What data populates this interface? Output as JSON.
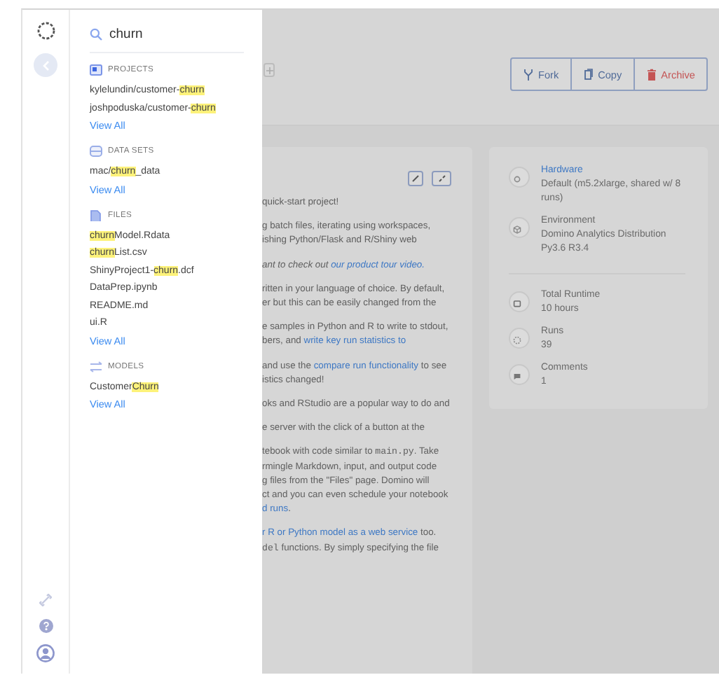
{
  "search": {
    "value": "churn"
  },
  "results": [
    {
      "kind": "projects",
      "heading": "PROJECTS",
      "items": [
        {
          "parts": [
            {
              "text": "kylelundin/customer-",
              "match": false
            },
            {
              "text": "churn",
              "match": true
            }
          ]
        },
        {
          "parts": [
            {
              "text": "joshpoduska/customer-",
              "match": false
            },
            {
              "text": "churn",
              "match": true
            }
          ]
        }
      ],
      "view_all": "View All"
    },
    {
      "kind": "datasets",
      "heading": "DATA SETS",
      "items": [
        {
          "parts": [
            {
              "text": "mac/",
              "match": false
            },
            {
              "text": "churn",
              "match": true
            },
            {
              "text": "_data",
              "match": false
            }
          ]
        }
      ],
      "view_all": "View All"
    },
    {
      "kind": "files",
      "heading": "FILES",
      "items": [
        {
          "parts": [
            {
              "text": "churn",
              "match": true
            },
            {
              "text": "Model.Rdata",
              "match": false
            }
          ]
        },
        {
          "parts": [
            {
              "text": "churn",
              "match": true
            },
            {
              "text": "List.csv",
              "match": false
            }
          ]
        },
        {
          "parts": [
            {
              "text": "ShinyProject1-",
              "match": false
            },
            {
              "text": "churn",
              "match": true
            },
            {
              "text": ".dcf",
              "match": false
            }
          ]
        },
        {
          "parts": [
            {
              "text": "DataPrep.ipynb",
              "match": false
            }
          ]
        },
        {
          "parts": [
            {
              "text": "README.md",
              "match": false
            }
          ]
        },
        {
          "parts": [
            {
              "text": "ui.R",
              "match": false
            }
          ]
        }
      ],
      "view_all": "View All"
    },
    {
      "kind": "models",
      "heading": "MODELS",
      "items": [
        {
          "parts": [
            {
              "text": "Customer",
              "match": false
            },
            {
              "text": "Churn",
              "match": true
            }
          ]
        }
      ],
      "view_all": "View All"
    }
  ],
  "header": {
    "actions": [
      {
        "kind": "fork",
        "label": "Fork"
      },
      {
        "kind": "copy",
        "label": "Copy"
      },
      {
        "kind": "archive",
        "label": "Archive"
      }
    ]
  },
  "readme": {
    "paragraphs": [
      {
        "emphasis": false,
        "lines": [
          [
            {
              "kind": "text",
              "text": "quick-start project!"
            }
          ]
        ]
      },
      {
        "emphasis": false,
        "lines": [
          [
            {
              "kind": "text",
              "text": "g batch files, iterating using workspaces,"
            }
          ],
          [
            {
              "kind": "text",
              "text": "ishing Python/Flask and R/Shiny web"
            }
          ]
        ]
      },
      {
        "emphasis": true,
        "lines": [
          [
            {
              "kind": "text",
              "text": "ant to check out "
            },
            {
              "kind": "link",
              "text": "our product tour video."
            }
          ]
        ]
      },
      {
        "emphasis": false,
        "lines": [
          [
            {
              "kind": "text",
              "text": "ritten in your language of choice. By default,"
            }
          ],
          [
            {
              "kind": "text",
              "text": "er but this can be easily changed from the"
            }
          ]
        ]
      },
      {
        "emphasis": false,
        "lines": [
          [
            {
              "kind": "text",
              "text": "e samples in Python and R to write to stdout,"
            }
          ],
          [
            {
              "kind": "text",
              "text": "bers, and "
            },
            {
              "kind": "link",
              "text": "write key run statistics to"
            }
          ]
        ]
      },
      {
        "emphasis": false,
        "lines": [
          [
            {
              "kind": "text",
              "text": "and use the "
            },
            {
              "kind": "link",
              "text": "compare run functionality"
            },
            {
              "kind": "text",
              "text": " to see"
            }
          ],
          [
            {
              "kind": "text",
              "text": "istics changed!"
            }
          ]
        ]
      },
      {
        "emphasis": false,
        "lines": [
          [
            {
              "kind": "text",
              "text": "oks and RStudio are a popular way to do and"
            }
          ]
        ]
      },
      {
        "emphasis": false,
        "lines": [
          [
            {
              "kind": "text",
              "text": "e server with the click of a button at the"
            }
          ]
        ]
      },
      {
        "emphasis": false,
        "lines": [
          [
            {
              "kind": "text",
              "text": "tebook with code similar to "
            },
            {
              "kind": "code",
              "text": "main.py"
            },
            {
              "kind": "text",
              "text": ". Take"
            }
          ],
          [
            {
              "kind": "text",
              "text": "rmingle Markdown, input, and output code"
            }
          ],
          [
            {
              "kind": "text",
              "text": "g files from the \"Files\" page. Domino will"
            }
          ],
          [
            {
              "kind": "text",
              "text": "ct and you can even schedule your notebook"
            }
          ],
          [
            {
              "kind": "link",
              "text": "d runs"
            },
            {
              "kind": "text",
              "text": "."
            }
          ]
        ]
      },
      {
        "emphasis": false,
        "lines": [
          [
            {
              "kind": "link",
              "text": "r R or Python model as a web service"
            },
            {
              "kind": "text",
              "text": " too."
            }
          ],
          [
            {
              "kind": "code",
              "text": "del"
            },
            {
              "kind": "text",
              "text": " functions. By simply specifying the file"
            }
          ]
        ]
      }
    ]
  },
  "details": [
    {
      "items": [
        {
          "kind": "hardware",
          "title": "Hardware",
          "link": true,
          "value": "Default (m5.2xlarge, shared w/ 8 runs)"
        },
        {
          "kind": "environment",
          "title": "Environment",
          "link": false,
          "value": "Domino Analytics Distribution Py3.6 R3.4"
        }
      ]
    },
    {
      "items": [
        {
          "kind": "runtime",
          "title": "Total Runtime",
          "link": false,
          "value": "10 hours"
        },
        {
          "kind": "runs",
          "title": "Runs",
          "link": false,
          "value": "39"
        },
        {
          "kind": "comments",
          "title": "Comments",
          "link": false,
          "value": "1"
        }
      ]
    }
  ]
}
